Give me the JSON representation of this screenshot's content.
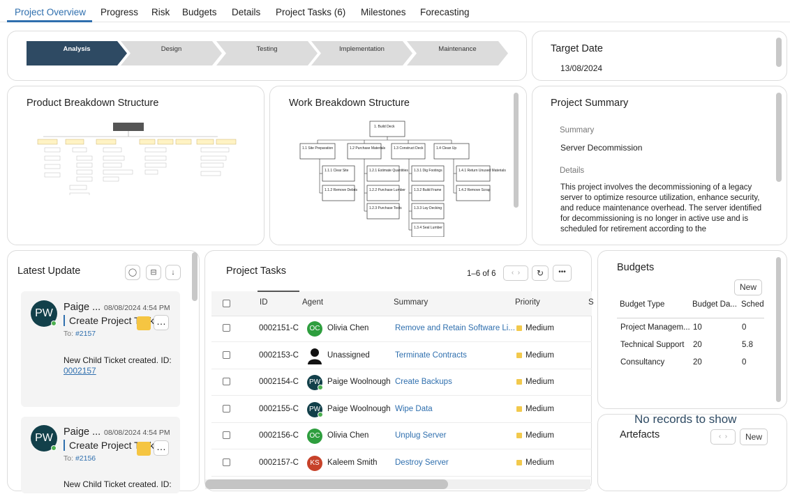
{
  "tabs": [
    "Project Overview",
    "Progress",
    "Risk",
    "Budgets",
    "Details",
    "Project Tasks (6)",
    "Milestones",
    "Forecasting"
  ],
  "stages": [
    "Analysis",
    "Design",
    "Testing",
    "Implementation",
    "Maintenance"
  ],
  "current_stage": "Analysis",
  "target_date": {
    "title": "Target Date",
    "value": "13/08/2024"
  },
  "pbs": {
    "title": "Product Breakdown Structure"
  },
  "wbs": {
    "title": "Work Breakdown Structure",
    "nodes": [
      "1. Build Deck",
      "1.1 Site Preparation",
      "1.2 Purchase Materials",
      "1.3 Construct Deck",
      "1.4 Clean Up",
      "1.1.1 Clear Site",
      "1.1.2 Remove Debris",
      "1.2.1 Estimate Quantities",
      "1.2.2 Purchase Lumber",
      "1.2.3 Purchase Tools",
      "1.3.1 Dig Footings",
      "1.3.2 Build Frame",
      "1.3.3 Lay Decking",
      "1.3.4 Seal Lumber",
      "1.4.1 Return Unused Materials",
      "1.4.2 Remove Scrap"
    ]
  },
  "summary": {
    "title": "Project Summary",
    "summary_label": "Summary",
    "summary_value": "Server Decommission",
    "details_label": "Details",
    "details_text": "This project involves the decommissioning of a legacy server to optimize resource utilization, enhance security, and reduce maintenance overhead. The server identified for decommissioning is no longer in active use and is scheduled for retirement according to the"
  },
  "latest_update": {
    "title": "Latest Update",
    "cards": [
      {
        "initials": "PW",
        "name": "Paige ...",
        "date": "08/08/2024 4:54 PM",
        "title": "Create Project Task...",
        "to_label": "To:",
        "to_link": "#2157",
        "body": "New Child Ticket created. ID:",
        "body_link": "0002157"
      },
      {
        "initials": "PW",
        "name": "Paige ...",
        "date": "08/08/2024 4:54 PM",
        "title": "Create Project Task...",
        "to_label": "To:",
        "to_link": "#2156",
        "body": "New Child Ticket created. ID:",
        "body_link": ""
      }
    ]
  },
  "tasks": {
    "title": "Project Tasks",
    "count": "1–6 of 6",
    "more": "•••",
    "columns": [
      "ID",
      "Agent",
      "Summary",
      "Priority",
      "S"
    ],
    "rows": [
      {
        "id": "0002151-C",
        "initials": "OC",
        "agent": "Olivia Chen",
        "summary": "Remove and Retain Software Li...",
        "priority": "Medium",
        "avatar": "oc"
      },
      {
        "id": "0002153-C",
        "initials": "",
        "agent": "Unassigned",
        "summary": "Terminate Contracts",
        "priority": "Medium",
        "avatar": "none"
      },
      {
        "id": "0002154-C",
        "initials": "PW",
        "agent": "Paige Woolnough",
        "summary": "Create Backups",
        "priority": "Medium",
        "avatar": "pw"
      },
      {
        "id": "0002155-C",
        "initials": "PW",
        "agent": "Paige Woolnough",
        "summary": "Wipe Data",
        "priority": "Medium",
        "avatar": "pw"
      },
      {
        "id": "0002156-C",
        "initials": "OC",
        "agent": "Olivia Chen",
        "summary": "Unplug Server",
        "priority": "Medium",
        "avatar": "oc"
      },
      {
        "id": "0002157-C",
        "initials": "KS",
        "agent": "Kaleem Smith",
        "summary": "Destroy Server",
        "priority": "Medium",
        "avatar": "ks"
      }
    ]
  },
  "budgets": {
    "title": "Budgets",
    "new_label": "New",
    "columns": [
      "Budget Type",
      "Budget Da...",
      "Sched"
    ],
    "rows": [
      {
        "type": "Project Managem...",
        "budget": "10",
        "sched": "0"
      },
      {
        "type": "Technical Support",
        "budget": "20",
        "sched": "5.8"
      },
      {
        "type": "Consultancy",
        "budget": "20",
        "sched": "0"
      }
    ]
  },
  "artefacts": {
    "title": "Artefacts",
    "empty_text": "No records to show",
    "new_label": "New"
  },
  "colors": {
    "accent": "#2f6fae",
    "stage_current": "#2e4a63",
    "stage_other": "#dcdcdc",
    "priority_medium": "#f2c94c"
  }
}
